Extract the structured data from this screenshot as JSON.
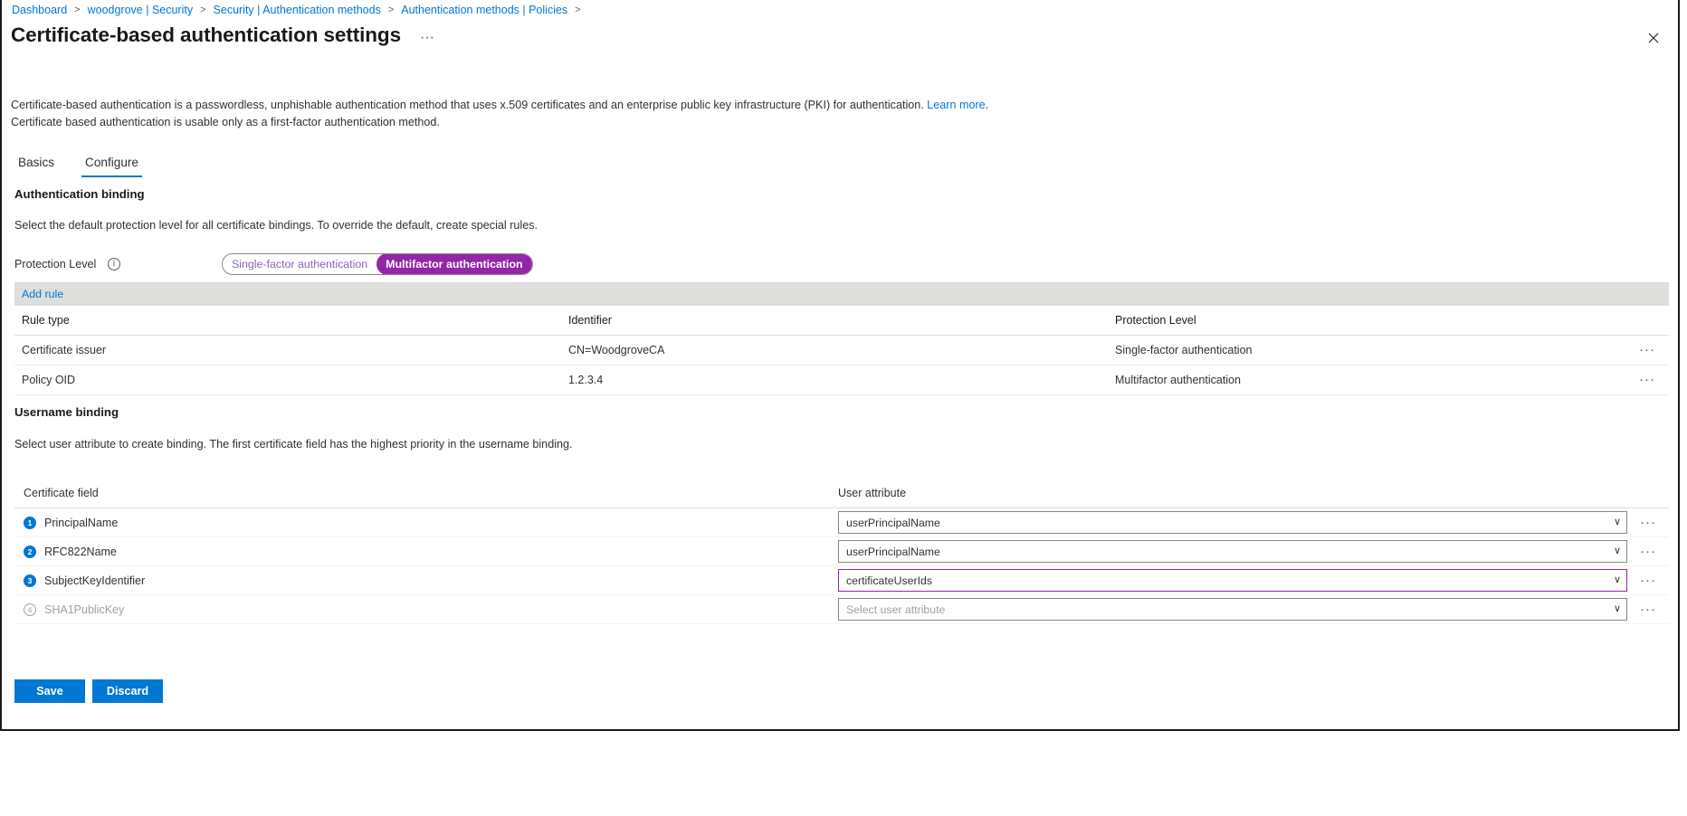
{
  "breadcrumb": {
    "items": [
      {
        "label": "Dashboard"
      },
      {
        "label": "woodgrove | Security"
      },
      {
        "label": "Security | Authentication methods"
      },
      {
        "label": "Authentication methods | Policies"
      }
    ],
    "separator": ">"
  },
  "header": {
    "title": "Certificate-based authentication settings",
    "overflow_label": "···",
    "close_label": "✕"
  },
  "intro": {
    "line1_part1": "Certificate-based authentication is a passwordless, unphishable authentication method that uses x.509 certificates and an enterprise public key infrastructure (PKI) for authentication. ",
    "learn_more": "Learn more",
    "line1_part2": ".",
    "line2": "Certificate based authentication is usable only as a first-factor authentication method."
  },
  "tabs": [
    {
      "label": "Basics",
      "active": false
    },
    {
      "label": "Configure",
      "active": true
    }
  ],
  "authentication_binding": {
    "heading": "Authentication binding",
    "description": "Select the default protection level for all certificate bindings. To override the default, create special rules.",
    "protection_level_label": "Protection Level",
    "info_icon_glyph": "i",
    "toggle_options": [
      {
        "label": "Single-factor authentication",
        "selected": false
      },
      {
        "label": "Multifactor authentication",
        "selected": true
      }
    ],
    "selected_protection_level": "Multifactor authentication",
    "accent_selected_color": "#9326a9",
    "accent_unselected_color": "#8764b8"
  },
  "rules": {
    "add_rule_label": "Add rule",
    "columns": [
      "Rule type",
      "Identifier",
      "Protection Level"
    ],
    "row_menu_label": "···",
    "rows": [
      {
        "rule_type": "Certificate issuer",
        "identifier": "CN=WoodgroveCA",
        "protection_level": "Single-factor authentication"
      },
      {
        "rule_type": "Policy OID",
        "identifier": "1.2.3.4",
        "protection_level": "Multifactor authentication"
      }
    ]
  },
  "username_binding": {
    "heading": "Username binding",
    "description": "Select user attribute to create binding. The first certificate field has the highest priority in the username binding.",
    "columns": [
      "Certificate field",
      "User attribute"
    ],
    "row_menu_label": "···",
    "chevron_glyph": "∨",
    "rows": [
      {
        "index": "1",
        "certificate_field": "PrincipalName",
        "user_attribute": "userPrincipalName",
        "placeholder": "Select user attribute",
        "enabled": true,
        "focused": false
      },
      {
        "index": "2",
        "certificate_field": "RFC822Name",
        "user_attribute": "userPrincipalName",
        "placeholder": "Select user attribute",
        "enabled": true,
        "focused": false
      },
      {
        "index": "3",
        "certificate_field": "SubjectKeyIdentifier",
        "user_attribute": "certificateUserIds",
        "placeholder": "Select user attribute",
        "enabled": true,
        "focused": true
      },
      {
        "index": "4",
        "certificate_field": "SHA1PublicKey",
        "user_attribute": "",
        "placeholder": "Select user attribute",
        "enabled": false,
        "focused": false
      }
    ]
  },
  "footer": {
    "save_label": "Save",
    "discard_label": "Discard",
    "primary_color": "#0078d4"
  }
}
